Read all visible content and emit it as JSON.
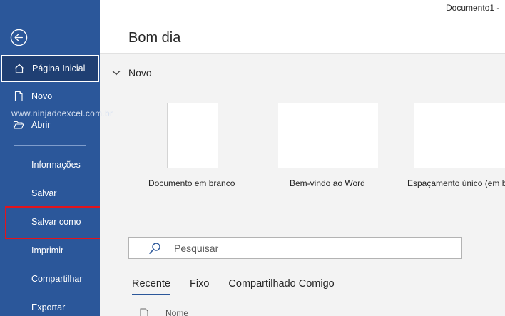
{
  "window": {
    "doc_title": "Documento1  -"
  },
  "sidebar": {
    "watermark": "www.ninjadoexcel.com.br",
    "items": [
      {
        "label": "Página Inicial",
        "icon": "home-icon"
      },
      {
        "label": "Novo",
        "icon": "new-document-icon"
      },
      {
        "label": "Abrir",
        "icon": "open-folder-icon"
      },
      {
        "label": "Informações"
      },
      {
        "label": "Salvar"
      },
      {
        "label": "Salvar como"
      },
      {
        "label": "Imprimir"
      },
      {
        "label": "Compartilhar"
      },
      {
        "label": "Exportar"
      }
    ],
    "colors": {
      "background": "#2b579a",
      "highlight": "#e3141c"
    }
  },
  "main": {
    "greeting": "Bom dia",
    "new_section": {
      "title": "Novo",
      "templates": [
        {
          "label": "Documento em branco"
        },
        {
          "label": "Bem-vindo ao Word"
        },
        {
          "label": "Espaçamento único (em b"
        }
      ]
    },
    "search": {
      "placeholder": "Pesquisar"
    },
    "tabs": [
      {
        "label": "Recente"
      },
      {
        "label": "Fixo"
      },
      {
        "label": "Compartilhado Comigo"
      }
    ],
    "file_list": {
      "name_header": "Nome"
    }
  }
}
